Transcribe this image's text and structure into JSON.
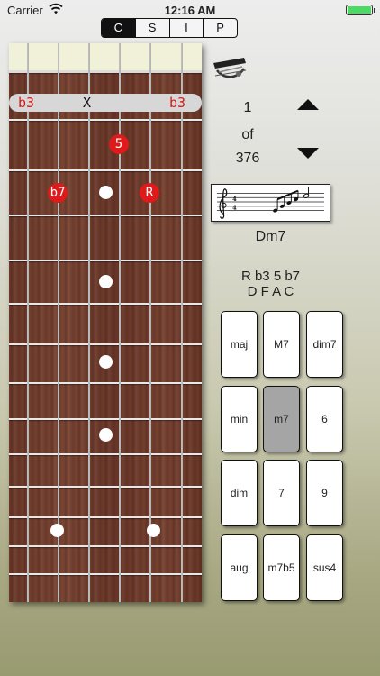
{
  "status_bar": {
    "carrier": "Carrier",
    "time": "12:16 AM"
  },
  "mode_tabs": [
    {
      "label": "C",
      "active": true
    },
    {
      "label": "S",
      "active": false
    },
    {
      "label": "I",
      "active": false
    },
    {
      "label": "P",
      "active": false
    }
  ],
  "fretboard": {
    "indicator": {
      "left": "b3",
      "middle": "X",
      "right": "b3"
    },
    "notes": [
      {
        "label": "5"
      },
      {
        "label": "b7"
      },
      {
        "label": "R"
      }
    ]
  },
  "position": {
    "current": "1",
    "of": "of",
    "total": "376"
  },
  "chord": {
    "name": "Dm7",
    "formula": "R b3 5 b7",
    "notes": "D F A C"
  },
  "chord_types": [
    {
      "label": "maj",
      "selected": false
    },
    {
      "label": "M7",
      "selected": false
    },
    {
      "label": "dim7",
      "selected": false
    },
    {
      "label": "min",
      "selected": false
    },
    {
      "label": "m7",
      "selected": true
    },
    {
      "label": "6",
      "selected": false
    },
    {
      "label": "dim",
      "selected": false
    },
    {
      "label": "7",
      "selected": false
    },
    {
      "label": "9",
      "selected": false
    },
    {
      "label": "aug",
      "selected": false
    },
    {
      "label": "m7b5",
      "selected": false
    },
    {
      "label": "sus4",
      "selected": false
    }
  ],
  "colors": {
    "note_marker": "#e01a1a",
    "selected_key": "#a5a5a5",
    "active_tab": "#111111"
  },
  "icons": {
    "capo": "capo-icon",
    "up": "arrow-up-icon",
    "down": "arrow-down-icon",
    "wifi": "wifi-icon",
    "battery": "battery-icon"
  }
}
